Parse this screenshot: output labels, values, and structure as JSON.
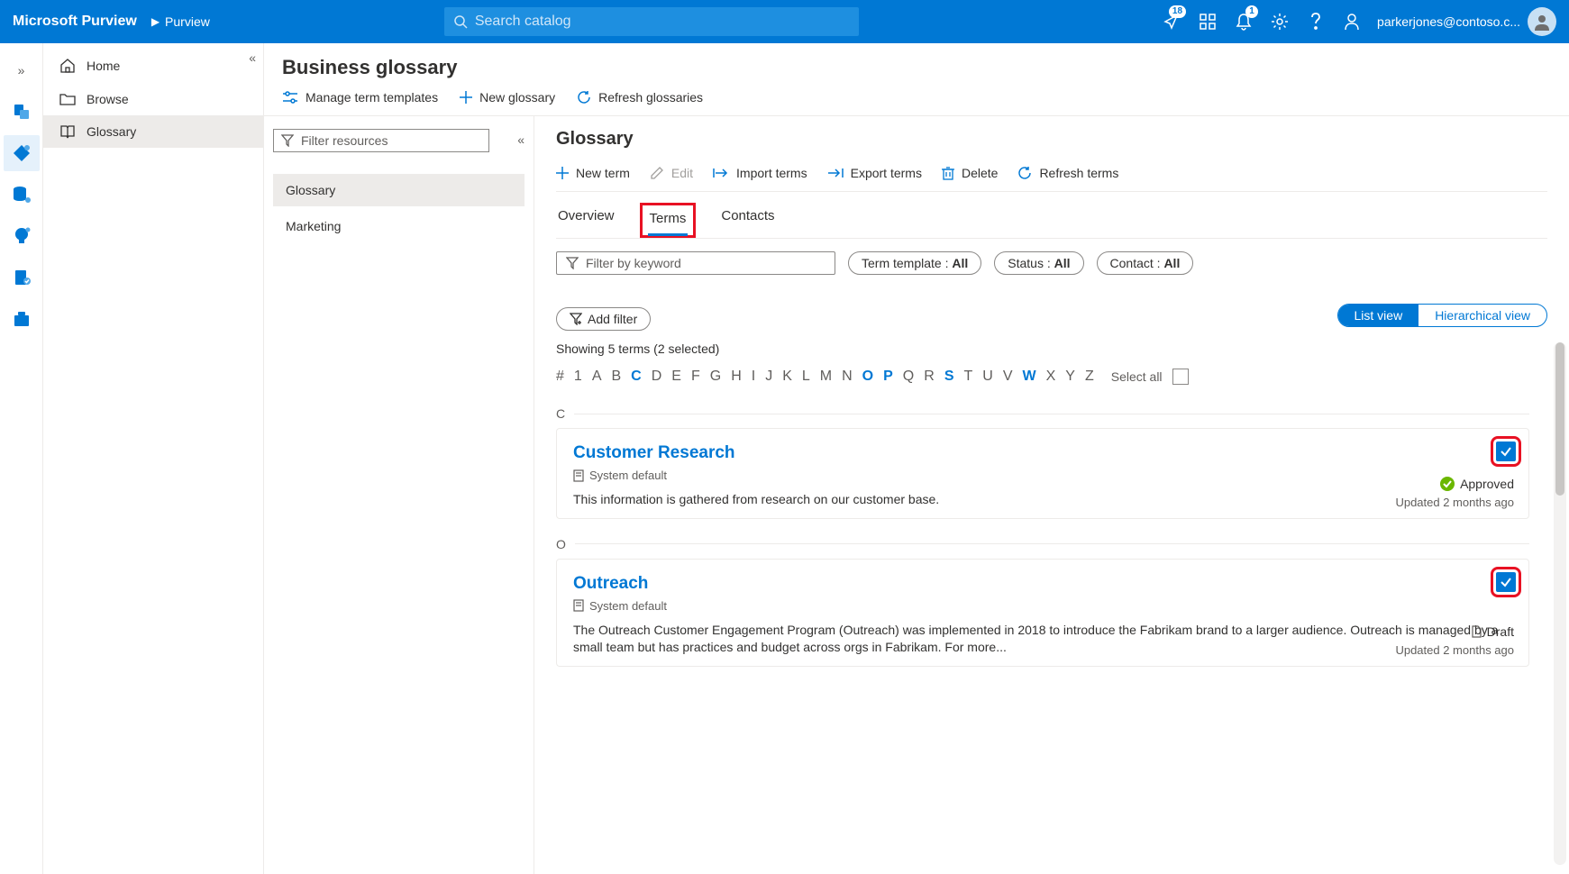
{
  "header": {
    "brand": "Microsoft Purview",
    "crumb": "Purview",
    "search_placeholder": "Search catalog",
    "notif_badge": "18",
    "bell_badge": "1",
    "user_email": "parkerjones@contoso.c..."
  },
  "nav": {
    "items": [
      {
        "label": "Home",
        "icon": "home-icon"
      },
      {
        "label": "Browse",
        "icon": "folder-icon"
      },
      {
        "label": "Glossary",
        "icon": "book-icon"
      }
    ],
    "active_index": 2
  },
  "title": "Business glossary",
  "commands": {
    "manage": "Manage term templates",
    "newg": "New glossary",
    "refresh": "Refresh glossaries"
  },
  "left": {
    "filter_placeholder": "Filter resources",
    "items": [
      "Glossary",
      "Marketing"
    ],
    "active_index": 0
  },
  "right": {
    "title": "Glossary",
    "actions": {
      "newterm": "New term",
      "edit": "Edit",
      "import": "Import terms",
      "export": "Export terms",
      "delete": "Delete",
      "refresh": "Refresh terms"
    },
    "tabs": {
      "overview": "Overview",
      "terms": "Terms",
      "contacts": "Contacts"
    },
    "filter_placeholder": "Filter by keyword",
    "pills": {
      "template_label": "Term template :",
      "template_val": "All",
      "status_label": "Status :",
      "status_val": "All",
      "contact_label": "Contact :",
      "contact_val": "All"
    },
    "addfilter": "Add filter",
    "view_list": "List view",
    "view_hier": "Hierarchical view",
    "showing": "Showing 5 terms (2 selected)",
    "alpha": [
      "#",
      "1",
      "A",
      "B",
      "C",
      "D",
      "E",
      "F",
      "G",
      "H",
      "I",
      "J",
      "K",
      "L",
      "M",
      "N",
      "O",
      "P",
      "Q",
      "R",
      "S",
      "T",
      "U",
      "V",
      "W",
      "X",
      "Y",
      "Z"
    ],
    "alpha_active": [
      "C",
      "O",
      "P",
      "S",
      "W"
    ],
    "select_all": "Select all",
    "groups": [
      {
        "letter": "C",
        "terms": [
          {
            "name": "Customer Research",
            "template": "System default",
            "desc": "This information is gathered from research on our customer base.",
            "status": "Approved",
            "status_kind": "approved",
            "updated": "Updated 2 months ago",
            "checked": true
          }
        ]
      },
      {
        "letter": "O",
        "terms": [
          {
            "name": "Outreach",
            "template": "System default",
            "desc": "The Outreach Customer Engagement Program (Outreach) was implemented in 2018 to introduce the Fabrikam brand to a larger audience. Outreach is managed by a small team but has practices and budget across orgs in Fabrikam. For more...",
            "status": "Draft",
            "status_kind": "draft",
            "updated": "Updated 2 months ago",
            "checked": true
          }
        ]
      }
    ]
  }
}
